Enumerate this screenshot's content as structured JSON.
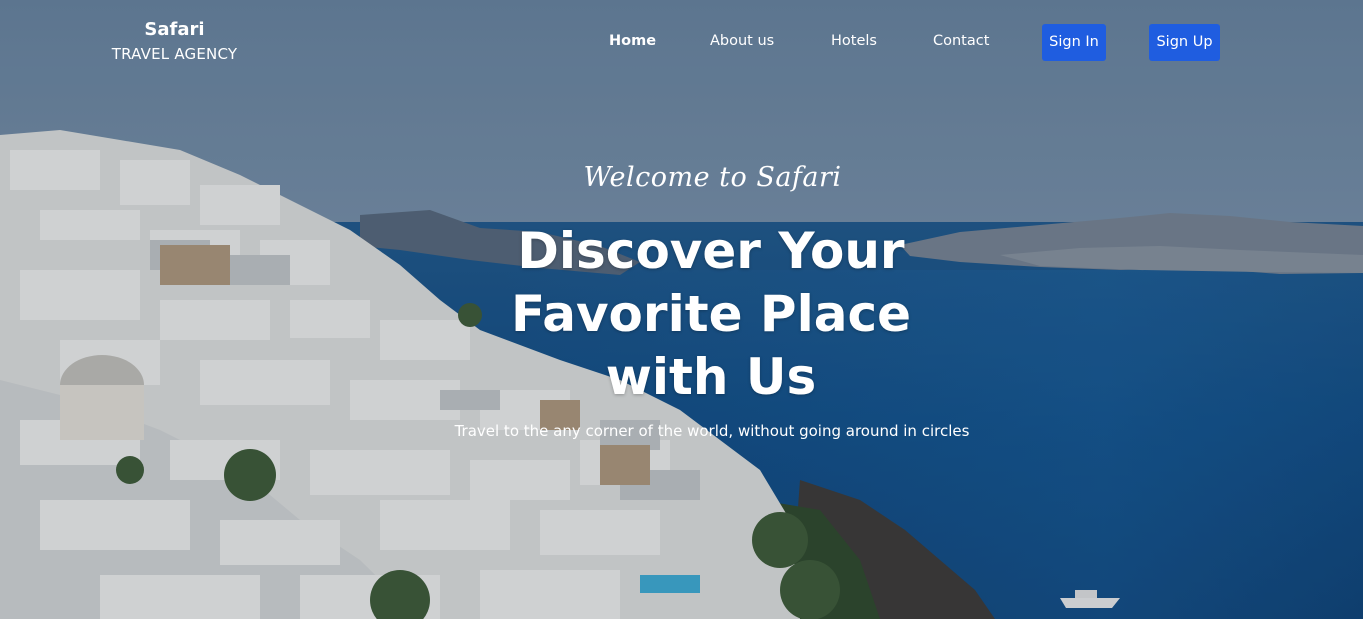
{
  "brand": {
    "name": "Safari",
    "subtitle": "TRAVEL AGENCY"
  },
  "nav": {
    "items": [
      {
        "label": "Home",
        "active": true
      },
      {
        "label": "About us",
        "active": false
      },
      {
        "label": "Hotels",
        "active": false
      },
      {
        "label": "Contact",
        "active": false
      }
    ],
    "sign_in_label": "Sign In",
    "sign_up_label": "Sign Up"
  },
  "hero": {
    "welcome": "Welcome to Safari",
    "headline_line1": "Discover Your",
    "headline_line2": "Favorite Place",
    "headline_line3": "with Us",
    "tagline": "Travel to the any corner of the world, without going around in circles",
    "background_image": "coastal white village on cliffs overlooking blue sea"
  },
  "colors": {
    "accent": "#1f5de0",
    "text": "#ffffff",
    "sky": "#6f8aa6",
    "sea": "#0f4f8a"
  }
}
